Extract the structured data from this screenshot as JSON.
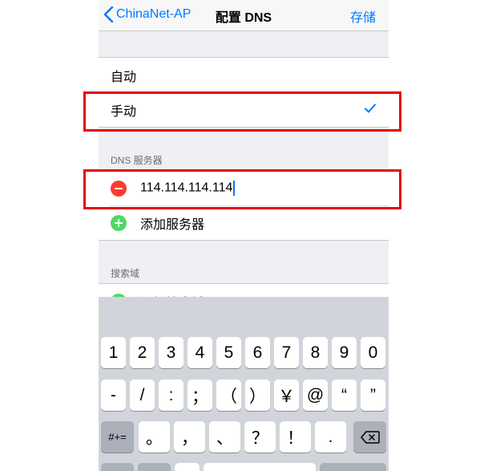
{
  "nav": {
    "back_label": "ChinaNet-AP",
    "title": "配置 DNS",
    "save_label": "存储"
  },
  "mode": {
    "options": [
      "自动",
      "手动"
    ],
    "selected": "手动"
  },
  "dns": {
    "header": "DNS 服务器",
    "server": "114.114.114.114",
    "add_label": "添加服务器"
  },
  "search": {
    "header": "搜索域",
    "add_label": "添加搜索域"
  },
  "keyboard": {
    "row1": [
      "1",
      "2",
      "3",
      "4",
      "5",
      "6",
      "7",
      "8",
      "9",
      "0"
    ],
    "row2": [
      "-",
      "/",
      ":",
      "；",
      "（",
      "）",
      "￥",
      "@",
      "“",
      "”"
    ],
    "row3_left": "#+=",
    "row3": [
      "。",
      "，",
      "、",
      "？",
      "！",
      "."
    ],
    "row3_right_icon": "backspace-icon"
  },
  "colors": {
    "accent": "#007aff",
    "delete": "#ff3b30",
    "add": "#4cd964",
    "highlight": "#e50012"
  }
}
